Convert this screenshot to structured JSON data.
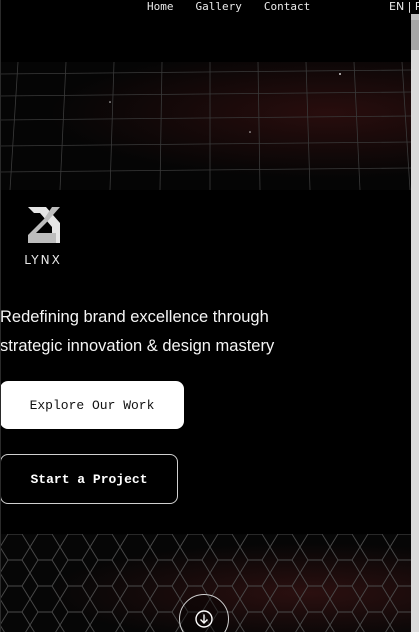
{
  "nav": {
    "items": [
      {
        "label": "Home"
      },
      {
        "label": "Gallery"
      },
      {
        "label": "Contact"
      }
    ],
    "language": "EN | P"
  },
  "brand": {
    "logo_text": "LYNX"
  },
  "hero": {
    "tagline_line1": "Redefining brand excellence through",
    "tagline_line2": "strategic innovation & design mastery",
    "primary_button": "Explore Our Work",
    "secondary_button": "Start a Project"
  },
  "icons": {
    "scroll_down": "arrow-down-icon",
    "logo": "lynx-logo-icon"
  },
  "colors": {
    "background": "#000000",
    "primary_button_bg": "#ffffff",
    "accent_glow": "#46141a"
  }
}
